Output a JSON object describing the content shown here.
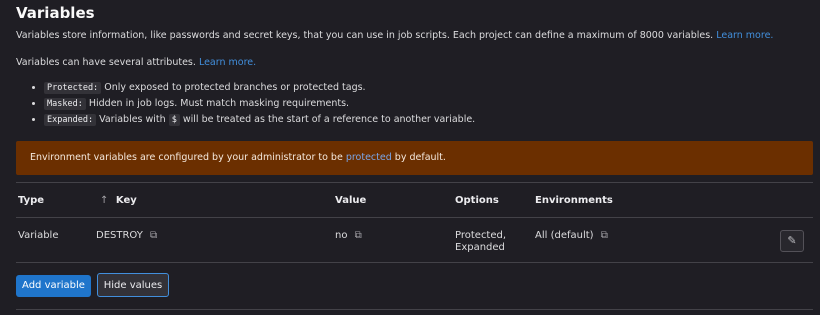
{
  "header": {
    "title": "Variables"
  },
  "intro": {
    "text": "Variables store information, like passwords and secret keys, that you can use in job scripts. Each project can define a maximum of 8000 variables.",
    "link": "Learn more."
  },
  "attributes": {
    "text": "Variables can have several attributes.",
    "link": "Learn more.",
    "items": [
      {
        "code": "Protected:",
        "text": "Only exposed to protected branches or protected tags."
      },
      {
        "code": "Masked:",
        "text": "Hidden in job logs. Must match masking requirements."
      },
      {
        "code": "Expanded:",
        "text_before": "Variables with",
        "symbol": "$",
        "text_after": "will be treated as the start of a reference to another variable."
      }
    ]
  },
  "banner": {
    "text_before": "Environment variables are configured by your administrator to be",
    "link": "protected",
    "text_after": "by default."
  },
  "table": {
    "columns": {
      "type": "Type",
      "key": "Key",
      "sort_icon": "↑",
      "value": "Value",
      "options": "Options",
      "environments": "Environments"
    },
    "rows": [
      {
        "type": "Variable",
        "key": "DESTROY",
        "value": "no",
        "options_line1": "Protected,",
        "options_line2": "Expanded",
        "environment": "All (default)"
      }
    ]
  },
  "buttons": {
    "add_variable": "Add variable",
    "hide_values": "Hide values"
  },
  "colors": {
    "background": "#1f1e24",
    "banner": "#6b2f00",
    "primary": "#1f75cb",
    "link": "#428fdc"
  }
}
